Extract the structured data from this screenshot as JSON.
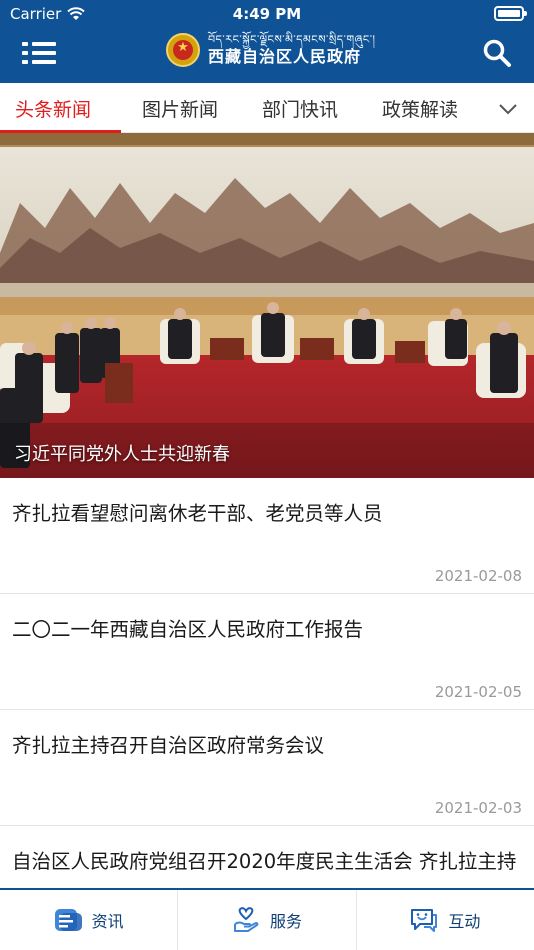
{
  "status_bar": {
    "carrier": "Carrier",
    "time": "4:49 PM"
  },
  "header": {
    "title_tibetan": "བོད་རང་སྐྱོང་ལྗོངས་མི་དམངས་སྲིད་གཞུང་།",
    "title_cn": "西藏自治区人民政府",
    "menu_icon": "list-menu-icon",
    "search_icon": "search-icon"
  },
  "tabs": [
    {
      "label": "头条新闻",
      "active": true
    },
    {
      "label": "图片新闻",
      "active": false
    },
    {
      "label": "部门快讯",
      "active": false
    },
    {
      "label": "政策解读",
      "active": false
    }
  ],
  "hero": {
    "caption": "习近平同党外人士共迎新春"
  },
  "news": [
    {
      "title": "齐扎拉看望慰问离休老干部、老党员等人员",
      "date": "2021-02-08"
    },
    {
      "title": "二〇二一年西藏自治区人民政府工作报告",
      "date": "2021-02-05"
    },
    {
      "title": "齐扎拉主持召开自治区政府常务会议",
      "date": "2021-02-03"
    },
    {
      "title": "自治区人民政府党组召开2020年度民主生活会 齐扎拉主持",
      "date": ""
    }
  ],
  "bottom_nav": [
    {
      "label": "资讯",
      "icon": "news-doc-icon"
    },
    {
      "label": "服务",
      "icon": "service-hand-icon"
    },
    {
      "label": "互动",
      "icon": "chat-bubble-icon"
    }
  ],
  "colors": {
    "header_bg": "#0f5396",
    "accent_red": "#e11d1d",
    "date_gray": "#9a9a9a"
  }
}
